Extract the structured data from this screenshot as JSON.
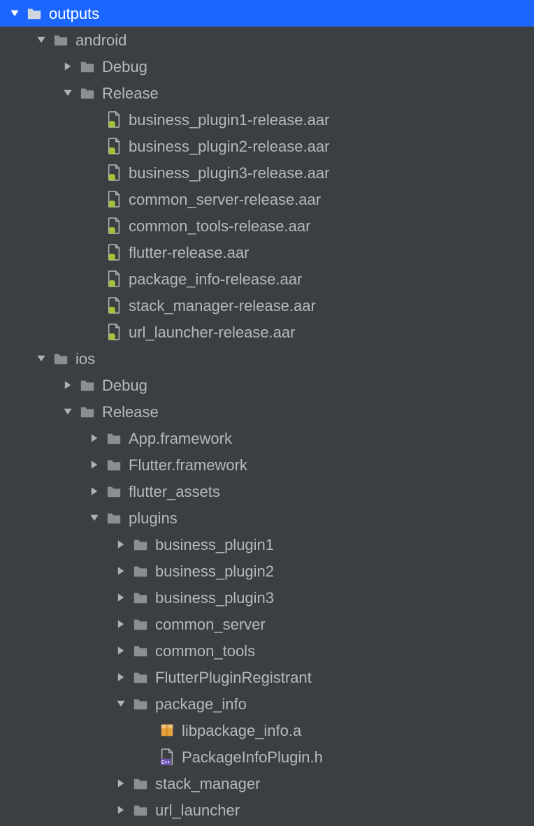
{
  "colors": {
    "bg": "#3c3f41",
    "text": "#b7b8b9",
    "selectedBg": "#1b66ff",
    "selectedText": "#ffffff",
    "folderGrey": "#8b8e92",
    "arrowGrey": "#afb1b3",
    "arrowWhite": "#ffffff",
    "androidGreen": "#a4c639",
    "fileOutline": "#b7b8b9",
    "archiveOrange": "#e6a23c",
    "cppPurple": "#6e4fb3"
  },
  "tree": [
    {
      "depth": 0,
      "arrow": "down",
      "icon": "folder",
      "label": "outputs",
      "selected": true
    },
    {
      "depth": 1,
      "arrow": "down",
      "icon": "folder",
      "label": "android"
    },
    {
      "depth": 2,
      "arrow": "right",
      "icon": "folder",
      "label": "Debug"
    },
    {
      "depth": 2,
      "arrow": "down",
      "icon": "folder",
      "label": "Release"
    },
    {
      "depth": 3,
      "arrow": "none",
      "icon": "aar",
      "label": "business_plugin1-release.aar"
    },
    {
      "depth": 3,
      "arrow": "none",
      "icon": "aar",
      "label": "business_plugin2-release.aar"
    },
    {
      "depth": 3,
      "arrow": "none",
      "icon": "aar",
      "label": "business_plugin3-release.aar"
    },
    {
      "depth": 3,
      "arrow": "none",
      "icon": "aar",
      "label": "common_server-release.aar"
    },
    {
      "depth": 3,
      "arrow": "none",
      "icon": "aar",
      "label": "common_tools-release.aar"
    },
    {
      "depth": 3,
      "arrow": "none",
      "icon": "aar",
      "label": "flutter-release.aar"
    },
    {
      "depth": 3,
      "arrow": "none",
      "icon": "aar",
      "label": "package_info-release.aar"
    },
    {
      "depth": 3,
      "arrow": "none",
      "icon": "aar",
      "label": "stack_manager-release.aar"
    },
    {
      "depth": 3,
      "arrow": "none",
      "icon": "aar",
      "label": "url_launcher-release.aar"
    },
    {
      "depth": 1,
      "arrow": "down",
      "icon": "folder",
      "label": "ios"
    },
    {
      "depth": 2,
      "arrow": "right",
      "icon": "folder",
      "label": "Debug"
    },
    {
      "depth": 2,
      "arrow": "down",
      "icon": "folder",
      "label": "Release"
    },
    {
      "depth": 3,
      "arrow": "right",
      "icon": "folder",
      "label": "App.framework"
    },
    {
      "depth": 3,
      "arrow": "right",
      "icon": "folder",
      "label": "Flutter.framework"
    },
    {
      "depth": 3,
      "arrow": "right",
      "icon": "folder",
      "label": "flutter_assets"
    },
    {
      "depth": 3,
      "arrow": "down",
      "icon": "folder",
      "label": "plugins"
    },
    {
      "depth": 4,
      "arrow": "right",
      "icon": "folder",
      "label": "business_plugin1"
    },
    {
      "depth": 4,
      "arrow": "right",
      "icon": "folder",
      "label": "business_plugin2"
    },
    {
      "depth": 4,
      "arrow": "right",
      "icon": "folder",
      "label": "business_plugin3"
    },
    {
      "depth": 4,
      "arrow": "right",
      "icon": "folder",
      "label": "common_server"
    },
    {
      "depth": 4,
      "arrow": "right",
      "icon": "folder",
      "label": "common_tools"
    },
    {
      "depth": 4,
      "arrow": "right",
      "icon": "folder",
      "label": "FlutterPluginRegistrant"
    },
    {
      "depth": 4,
      "arrow": "down",
      "icon": "folder",
      "label": "package_info"
    },
    {
      "depth": 5,
      "arrow": "none",
      "icon": "archive",
      "label": "libpackage_info.a"
    },
    {
      "depth": 5,
      "arrow": "none",
      "icon": "cpp-header",
      "label": "PackageInfoPlugin.h"
    },
    {
      "depth": 4,
      "arrow": "right",
      "icon": "folder",
      "label": "stack_manager"
    },
    {
      "depth": 4,
      "arrow": "right",
      "icon": "folder",
      "label": "url_launcher"
    }
  ]
}
